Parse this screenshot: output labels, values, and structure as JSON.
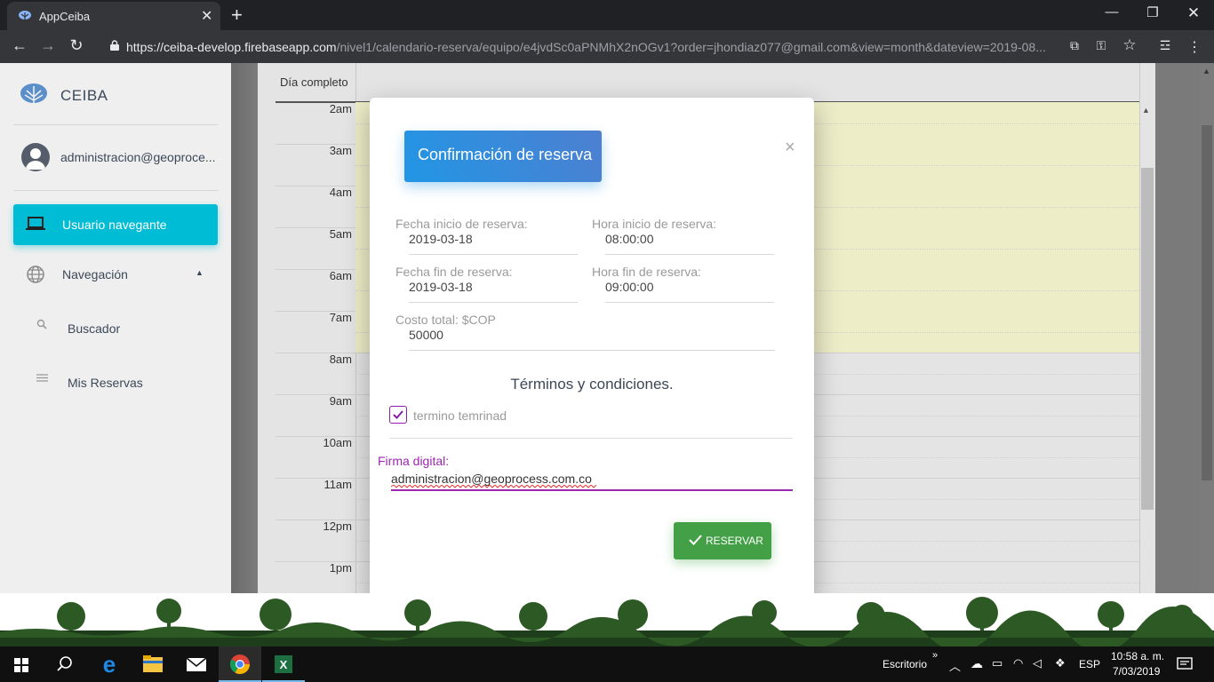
{
  "browser": {
    "tab_title": "AppCeiba",
    "url_host": "https://ceiba-develop.firebaseapp.com",
    "url_path": "/nivel1/calendario-reserva/equipo/e4jvdSc0aPNMhX2nOGv1?order=jhondiaz077@gmail.com&view=month&dateview=2019-08..."
  },
  "sidebar": {
    "brand": "CEIBA",
    "user": "administracion@geoproce...",
    "active_item": "Usuario navegante",
    "section": "Navegación",
    "items": [
      "Buscador",
      "Mis Reservas"
    ]
  },
  "calendar": {
    "all_day": "Día completo",
    "hours": [
      "2am",
      "3am",
      "4am",
      "5am",
      "6am",
      "7am",
      "8am",
      "9am",
      "10am",
      "11am",
      "12pm",
      "1pm"
    ]
  },
  "modal": {
    "title": "Confirmación de reserva",
    "close": "×",
    "start_date_label": "Fecha inicio de reserva:",
    "start_date": "2019-03-18",
    "start_time_label": "Hora inicio de reserva:",
    "start_time": "08:00:00",
    "end_date_label": "Fecha fin de reserva:",
    "end_date": "2019-03-18",
    "end_time_label": "Hora fin de reserva:",
    "end_time": "09:00:00",
    "cost_label": "Costo total: $COP",
    "cost": "50000",
    "terms_title": "Términos y condiciones.",
    "terms_checkbox": "termino temrinad",
    "signature_label": "Firma digital:",
    "signature_value": "administracion@geoprocess.com.co",
    "submit": "RESERVAR"
  },
  "taskbar": {
    "desktop": "Escritorio",
    "language": "ESP",
    "time": "10:58 a. m.",
    "date": "7/03/2019"
  },
  "colors": {
    "accent_cyan": "#00bcd4",
    "header_blue": "#2196e5",
    "submit_green": "#43a047",
    "focus_purple": "#9c27b0",
    "slot_highlight": "#ededc8"
  }
}
